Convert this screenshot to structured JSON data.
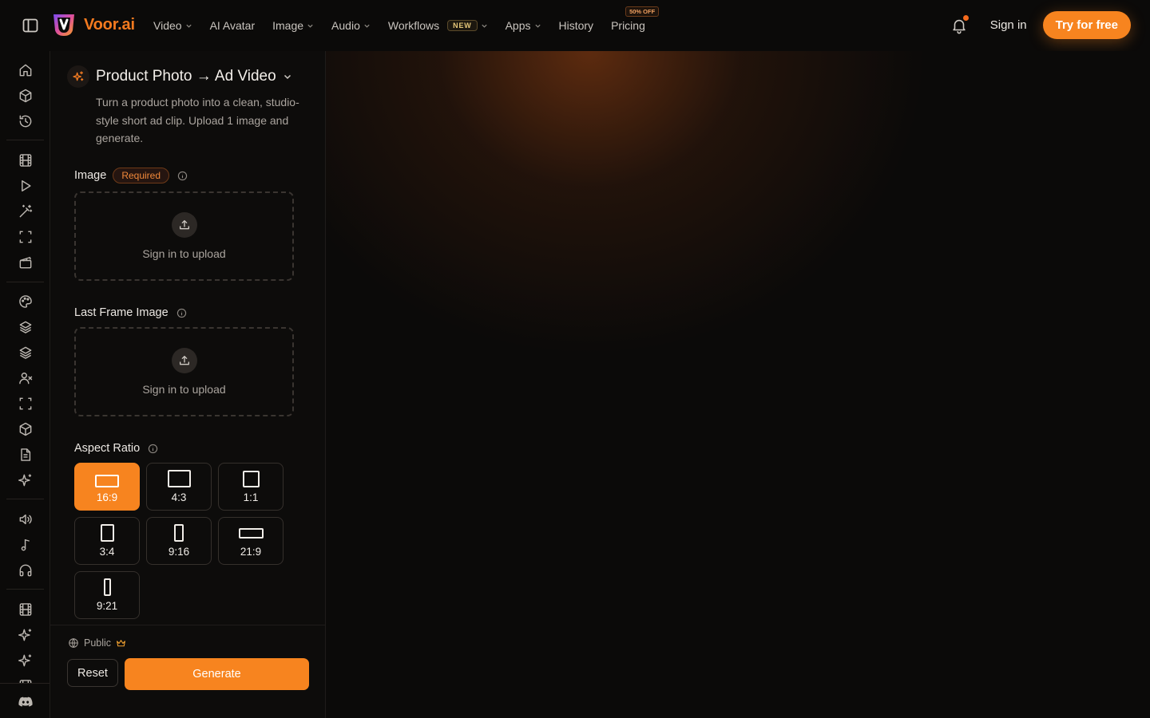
{
  "brand": {
    "name": "Voor.ai"
  },
  "nav": [
    {
      "label": "Video",
      "has_dropdown": true
    },
    {
      "label": "AI Avatar",
      "has_dropdown": false
    },
    {
      "label": "Image",
      "has_dropdown": true
    },
    {
      "label": "Audio",
      "has_dropdown": true
    },
    {
      "label": "Workflows",
      "badge": "NEW",
      "has_dropdown": true
    },
    {
      "label": "Apps",
      "has_dropdown": true
    },
    {
      "label": "History",
      "has_dropdown": false
    },
    {
      "label": "Pricing",
      "badge": "50% OFF",
      "has_dropdown": false
    }
  ],
  "header": {
    "signin_label": "Sign in",
    "cta_label": "Try for free",
    "notification_dot": true
  },
  "colors": {
    "accent": "#f7841f",
    "brand": "#f47a1f",
    "background": "#0b0a09"
  },
  "rail_icons": [
    "home-icon",
    "box-icon",
    "history-icon",
    "film-icon",
    "play-icon",
    "magic-wand-icon",
    "scan-icon",
    "clapperboard-icon",
    "palette-icon",
    "layers-icon",
    "layers-alt-icon",
    "user-x-icon",
    "scan-alt-icon",
    "package-icon",
    "document-icon",
    "sparkles-icon",
    "speaker-icon",
    "music-note-icon",
    "headphones-icon",
    "film-alt-icon",
    "sparkles-alt-icon",
    "sparkles-star-icon",
    "film-partial-icon",
    "discord-icon"
  ],
  "workflow": {
    "title": "Product Photo → Ad Video",
    "description": "Turn a product photo into a clean, studio-style short ad clip. Upload 1 image and generate."
  },
  "form": {
    "image": {
      "label": "Image",
      "required_badge": "Required",
      "upload_text": "Sign in to upload"
    },
    "last_frame": {
      "label": "Last Frame Image",
      "upload_text": "Sign in to upload"
    },
    "aspect_ratio": {
      "label": "Aspect Ratio",
      "selected": "16:9",
      "options": [
        "16:9",
        "4:3",
        "1:1",
        "3:4",
        "9:16",
        "21:9",
        "9:21"
      ]
    }
  },
  "footer": {
    "visibility_label": "Public",
    "reset_label": "Reset",
    "generate_label": "Generate"
  }
}
